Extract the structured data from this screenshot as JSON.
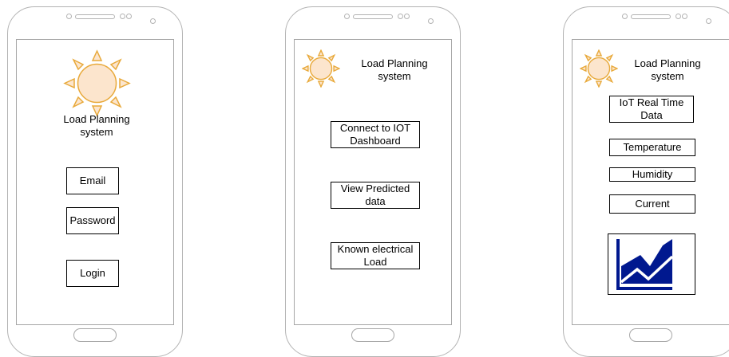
{
  "screens": {
    "login": {
      "app_title": "Load Planning system",
      "email_field": "Email",
      "password_field": "Password",
      "login_button": "Login"
    },
    "menu": {
      "app_title": "Load Planning system",
      "connect_button": "Connect to IOT Dashboard",
      "predicted_button": "View Predicted data",
      "known_load_button": "Known electrical Load"
    },
    "iot": {
      "app_title": "Load Planning system",
      "header": "IoT Real Time Data",
      "temperature": "Temperature",
      "humidity": "Humidity",
      "current": "Current",
      "chart_icon": "area-chart-icon"
    }
  },
  "colors": {
    "sun_fill": "#fce5cd",
    "sun_stroke": "#e8a93a",
    "chart_fill": "#00188f"
  }
}
